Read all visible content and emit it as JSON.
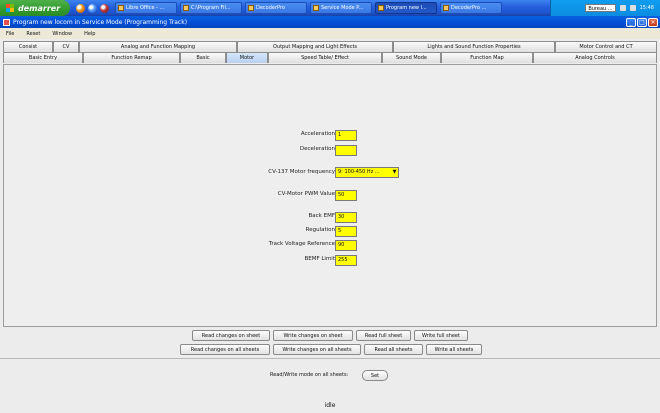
{
  "taskbar": {
    "start_label": "demarrer",
    "tasks": [
      {
        "label": "Libre Office - ..."
      },
      {
        "label": "C:\\Program Fil..."
      },
      {
        "label": "DecoderPro"
      },
      {
        "label": "Service Mode P..."
      },
      {
        "label": "Program new l..."
      },
      {
        "label": "DecoderPro ..."
      }
    ],
    "tray_box": "Bureau  ...",
    "clock": "15:48"
  },
  "window": {
    "title": "Program new locom in Service Mode (Programming Track)",
    "menu": [
      "File",
      "Reset",
      "Window",
      "Help"
    ]
  },
  "tabs_row1": [
    "Consist",
    "CV",
    "Analog and Function Mapping",
    "Output Mapping and Light Effects",
    "Lights and Sound Function Properties",
    "Motor Control and CT"
  ],
  "tabs_row2": [
    "Basic Entry",
    "Function Remap",
    "Basic",
    "Motor",
    "Speed Table/ Effect",
    "Sound Mode",
    "Function Map",
    "Analog Controls"
  ],
  "selected_tab": "Motor",
  "fields": {
    "acceleration": {
      "label": "Acceleration",
      "value": "1"
    },
    "deceleration": {
      "label": "Deceleration",
      "value": ""
    },
    "pwm_freq": {
      "label": "CV-137 Motor frequency",
      "value": "9: 100-450 Hz ..."
    },
    "pwm_value": {
      "label": "CV-Motor PWM Value",
      "value": "50"
    },
    "back_emf": {
      "label": "Back EMF",
      "value": "30"
    },
    "pid_setting": {
      "label": "Regulation",
      "value": "5"
    },
    "track_voltage": {
      "label": "Track Voltage Reference",
      "value": "90"
    },
    "bemf_limit": {
      "label": "BEMF Limit",
      "value": "255"
    }
  },
  "buttons": {
    "read_changes_sheet": "Read changes on sheet",
    "write_changes_sheet": "Write changes on sheet",
    "read_full_sheet": "Read full sheet",
    "write_full_sheet": "Write full sheet",
    "read_changes_all": "Read changes on all sheets",
    "write_changes_all": "Write changes on all sheets",
    "read_all": "Read all sheets",
    "write_all": "Write all sheets",
    "set": "Set"
  },
  "readall_label": "Read/Write mode on all sheets:",
  "status": "idle"
}
